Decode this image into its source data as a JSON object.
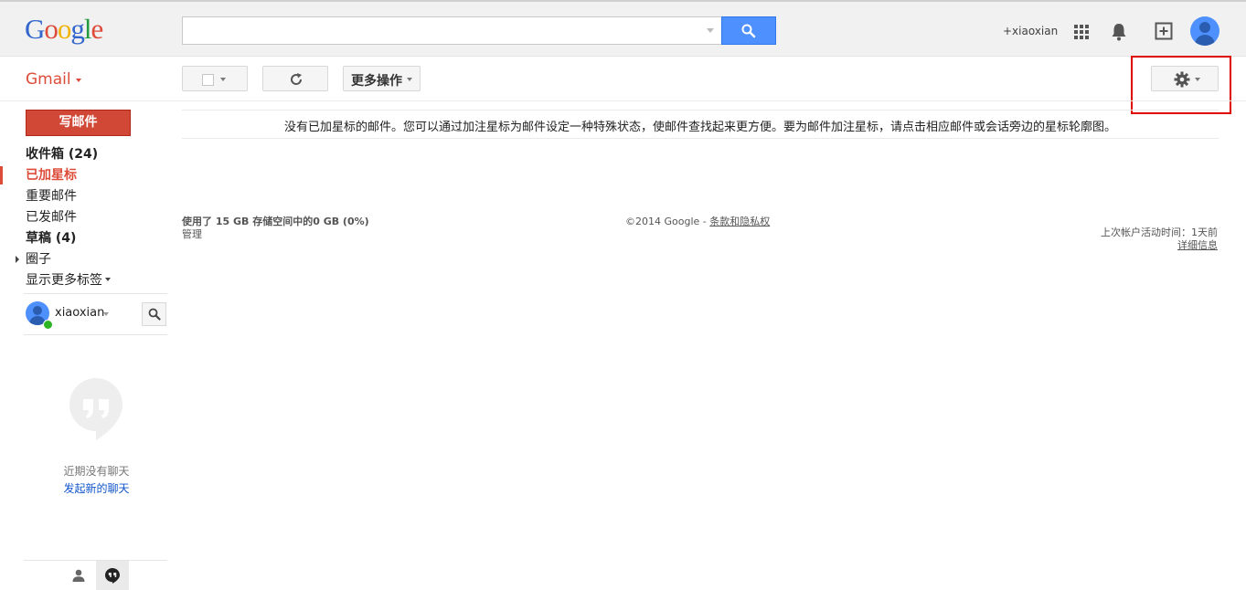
{
  "header": {
    "logo_letters": [
      "G",
      "o",
      "o",
      "g",
      "l",
      "e"
    ],
    "logo_colors": [
      "#3366cc",
      "#dd4b39",
      "#f2b40b",
      "#3366cc",
      "#209a3c",
      "#dd4b39"
    ],
    "search_value": "",
    "user_link": "+xiaoxian",
    "accent": "#4d90fe"
  },
  "toolbar": {
    "app_label": "Gmail",
    "more_actions": "更多操作",
    "app_color": "#dd4b39"
  },
  "sidebar": {
    "compose": "写邮件",
    "items": [
      {
        "label": "收件箱 (24)",
        "state": "bold"
      },
      {
        "label": "已加星标",
        "state": "active"
      },
      {
        "label": "重要邮件",
        "state": "normal"
      },
      {
        "label": "已发邮件",
        "state": "normal"
      },
      {
        "label": "草稿 (4)",
        "state": "bold"
      },
      {
        "label": "圈子",
        "state": "normal"
      },
      {
        "label": "显示更多标签",
        "state": "normal"
      }
    ]
  },
  "chat": {
    "user_name": "xiaoxian",
    "empty_text": "近期没有聊天",
    "new_chat_link": "发起新的聊天"
  },
  "main": {
    "empty_message": "没有已加星标的邮件。您可以通过加注星标为邮件设定一种特殊状态，使邮件查找起来更方便。要为邮件加注星标，请点击相应邮件或会话旁边的星标轮廓图。"
  },
  "footer": {
    "storage": "使用了 15 GB 存储空间中的0 GB (0%)",
    "manage": "管理",
    "copyright": "©2014 Google - ",
    "terms": "条款和隐私权",
    "last_activity": "上次帐户活动时间：1天前",
    "details": "详细信息"
  }
}
